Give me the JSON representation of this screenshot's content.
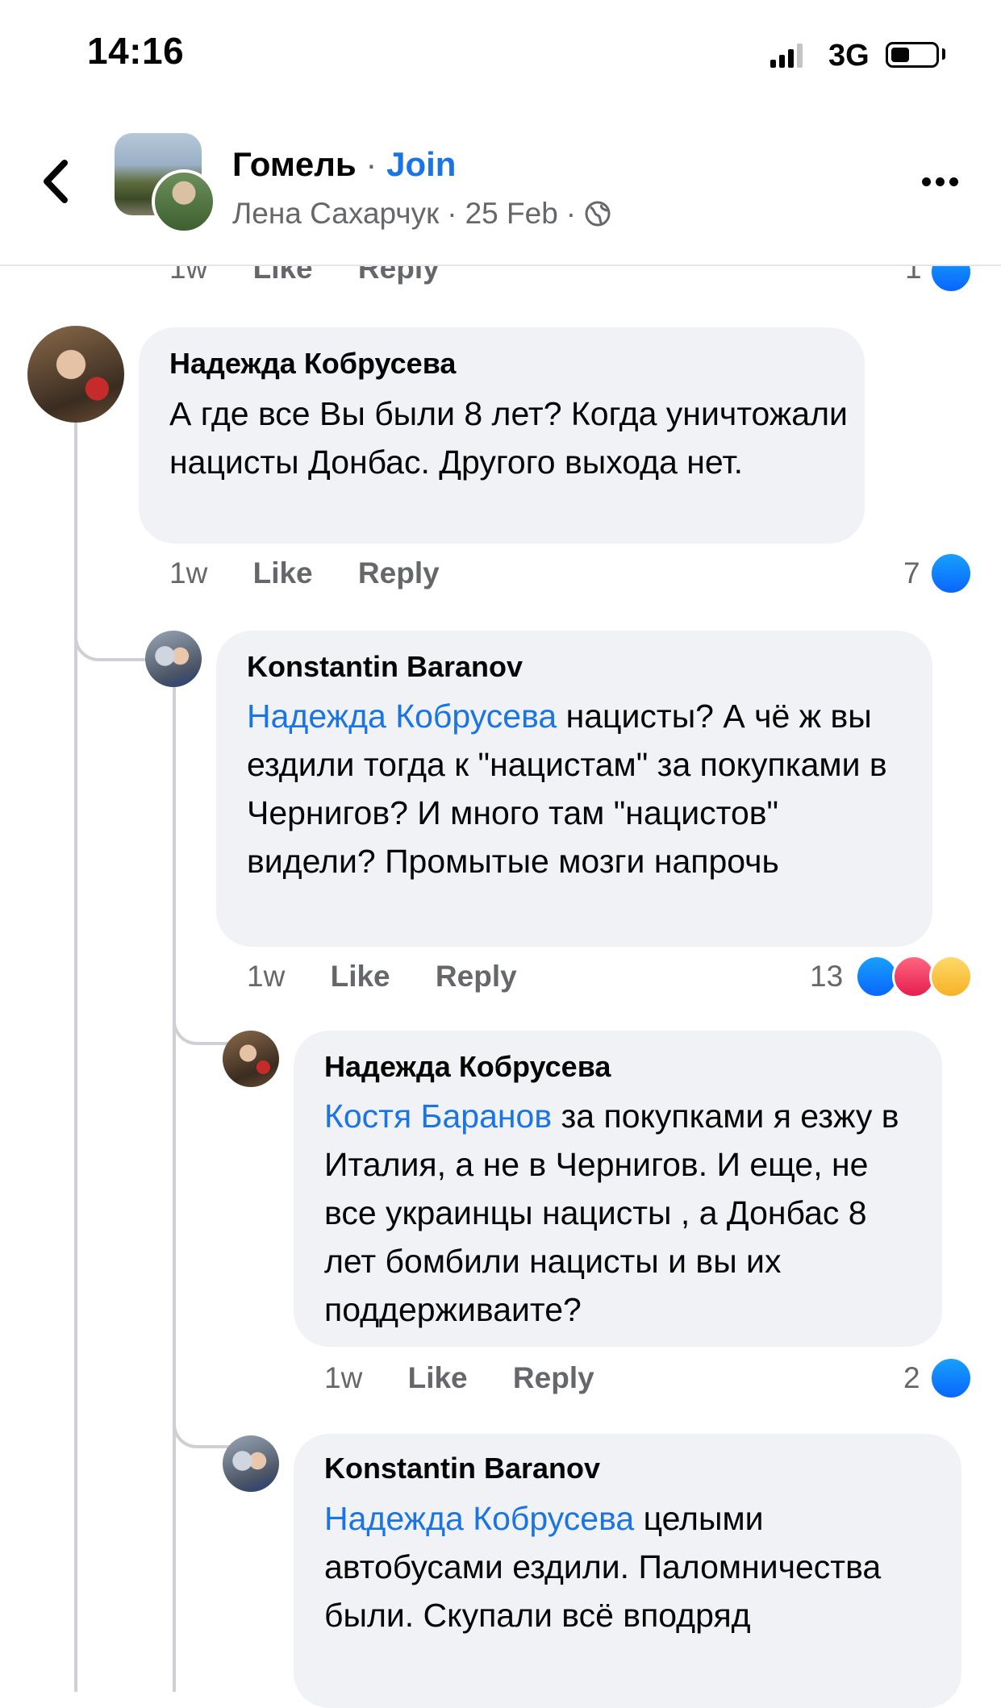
{
  "status_bar": {
    "time": "14:16",
    "network": "3G"
  },
  "header": {
    "group_name": "Гомель",
    "separator": "·",
    "join_label": "Join",
    "author": "Лена Сахарчук",
    "date": "25 Feb",
    "sub_sep": "·"
  },
  "partial_row": {
    "time": "1w",
    "like": "Like",
    "reply": "Reply",
    "count": "1"
  },
  "comments": [
    {
      "author": "Надежда Кобрусева",
      "text": "А где все  Вы  были 8 лет? Когда уничтожали нацисты Донбас. Другого выхода нет.",
      "time": "1w",
      "like": "Like",
      "reply": "Reply",
      "reaction_count": "7"
    },
    {
      "author": "Konstantin  Baranov",
      "mention": "Надежда Кобрусева",
      "text": " нацисты? А чё ж вы ездили тогда к \"нацистам\" за покупками в Чернигов? И много там \"нацистов\" видели? Промытые мозги напрочь",
      "time": "1w",
      "like": "Like",
      "reply": "Reply",
      "reaction_count": "13"
    },
    {
      "author": "Надежда Кобрусева",
      "mention": "Костя Баранов",
      "text": "  за покупками я езжу в Италия, а не в Чернигов. И еще, не все украинцы нацисты , а Донбас 8 лет бомбили нацисты и вы их поддерживаите?",
      "time": "1w",
      "like": "Like",
      "reply": "Reply",
      "reaction_count": "2"
    },
    {
      "author": "Konstantin  Baranov",
      "mention": "Надежда Кобрусева",
      "text": " целыми автобусами ездили. Паломничества были. Скупали всё вподряд"
    }
  ],
  "colors": {
    "link": "#1b74e4",
    "bubble": "#f0f2f5",
    "muted": "#65676b"
  }
}
